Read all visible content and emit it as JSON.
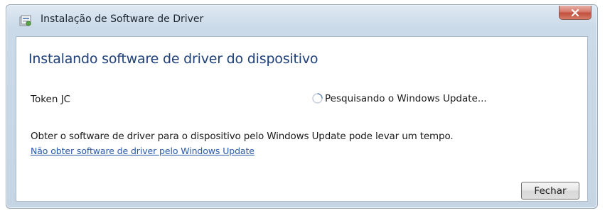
{
  "window": {
    "title": "Instalação de Software de Driver",
    "title_icon": "driver-install-icon",
    "close_icon": "close-icon",
    "close_color": "#c14f3e"
  },
  "main": {
    "heading": "Instalando software de driver do dispositivo",
    "device_name": "Token JC",
    "status_icon": "spinner-icon",
    "status_text": "Pesquisando o Windows Update...",
    "info_text": "Obter o software de driver para o dispositivo pelo Windows Update pode levar um tempo.",
    "skip_link": "Não obter software de driver pelo Windows Update",
    "close_button_label": "Fechar"
  },
  "colors": {
    "heading": "#1e3f78",
    "link": "#2a5aa8",
    "frame": "#c6d5e4"
  }
}
